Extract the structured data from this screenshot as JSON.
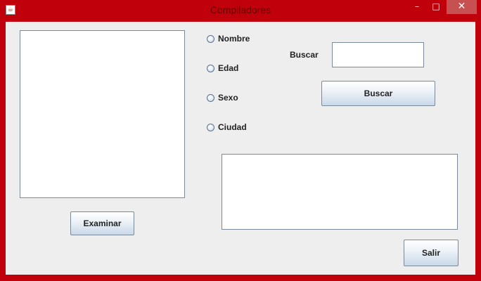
{
  "window": {
    "title": "Compiladores",
    "app_icon": "java-cup-icon",
    "controls": {
      "minimize": "–",
      "maximize": "□",
      "close": "✕"
    }
  },
  "radios": [
    {
      "label": "Nombre",
      "selected": false
    },
    {
      "label": "Edad",
      "selected": false
    },
    {
      "label": "Sexo",
      "selected": false
    },
    {
      "label": "Ciudad",
      "selected": false
    }
  ],
  "search": {
    "label": "Buscar",
    "value": "",
    "button_label": "Buscar"
  },
  "browse_button_label": "Examinar",
  "exit_button_label": "Salir",
  "colors": {
    "frame": "#c0000a",
    "close_button": "#c75050",
    "client_bg": "#eeeeee"
  }
}
